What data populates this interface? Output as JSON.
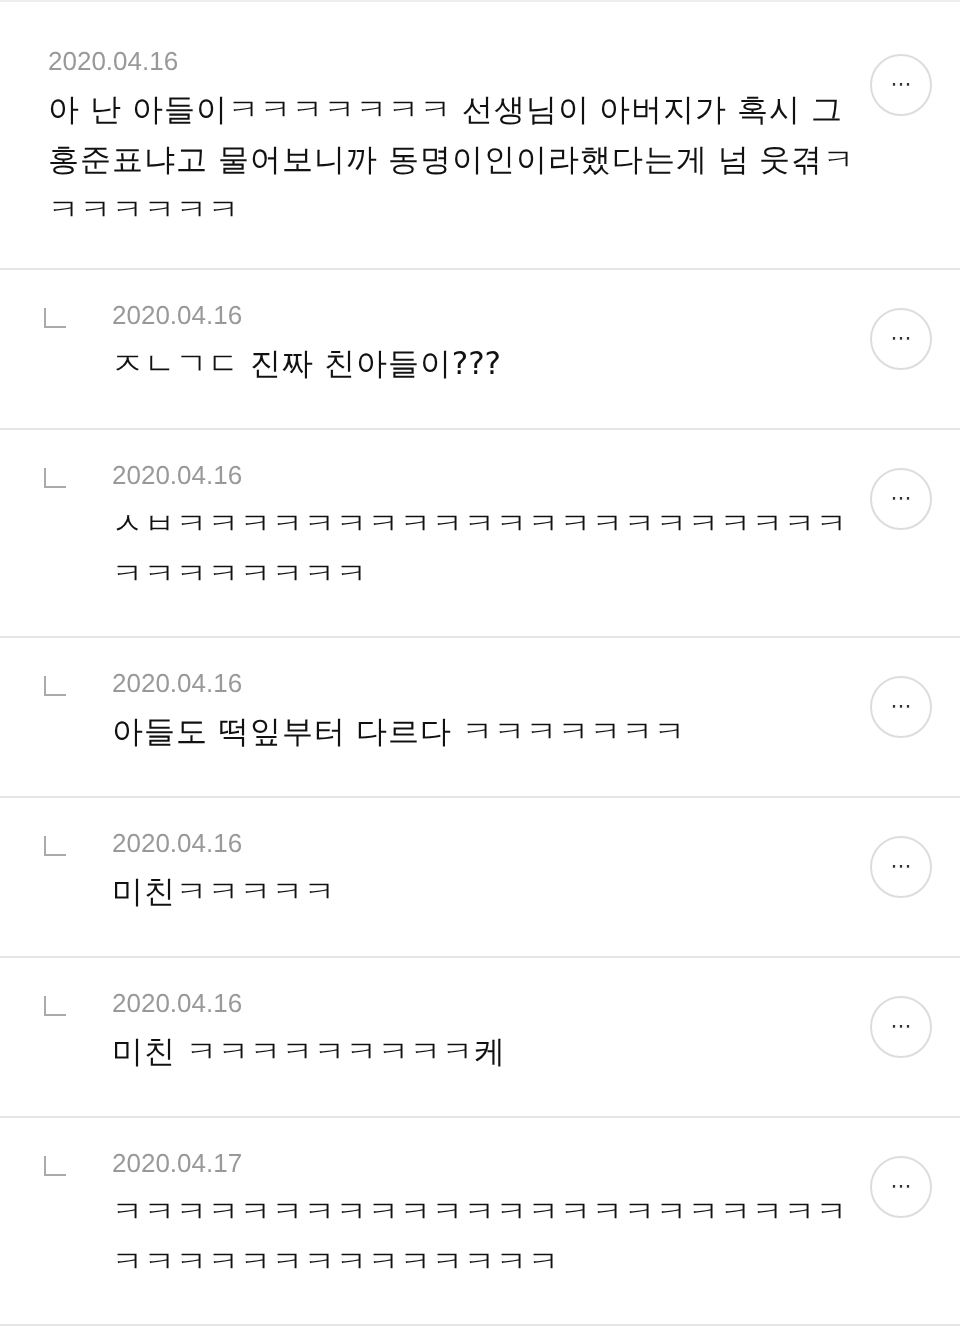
{
  "comments": [
    {
      "kind": "comment",
      "date": "2020.04.16",
      "text": "아 난 아들이ㅋㅋㅋㅋㅋㅋㅋ 선생님이 아버지가 혹시 그 홍준표냐고 물어보니까 동명이인이라했다는게 넘 웃겪ㅋㅋㅋㅋㅋㅋㅋ",
      "more": "···"
    },
    {
      "kind": "reply",
      "date": "2020.04.16",
      "text": "ㅈㄴㄱㄷ 진짜 친아들이???",
      "more": "···"
    },
    {
      "kind": "reply",
      "date": "2020.04.16",
      "text": "ㅅㅂㅋㅋㅋㅋㅋㅋㅋㅋㅋㅋㅋㅋㅋㅋㅋㅋㅋㅋㅋㅋㅋㅋㅋㅋㅋㅋㅋㅋㅋ",
      "more": "···"
    },
    {
      "kind": "reply",
      "date": "2020.04.16",
      "text": "아들도 떡잎부터 다르다 ㅋㅋㅋㅋㅋㅋㅋ",
      "more": "···"
    },
    {
      "kind": "reply",
      "date": "2020.04.16",
      "text": "미친ㅋㅋㅋㅋㅋ",
      "more": "···"
    },
    {
      "kind": "reply",
      "date": "2020.04.16",
      "text": "미친 ㅋㅋㅋㅋㅋㅋㅋㅋㅋ케",
      "more": "···"
    },
    {
      "kind": "reply",
      "date": "2020.04.17",
      "text": "ㅋㅋㅋㅋㅋㅋㅋㅋㅋㅋㅋㅋㅋㅋㅋㅋㅋㅋㅋㅋㅋㅋㅋㅋㅋㅋㅋㅋㅋㅋㅋㅋㅋㅋㅋㅋㅋ",
      "more": "···"
    }
  ]
}
